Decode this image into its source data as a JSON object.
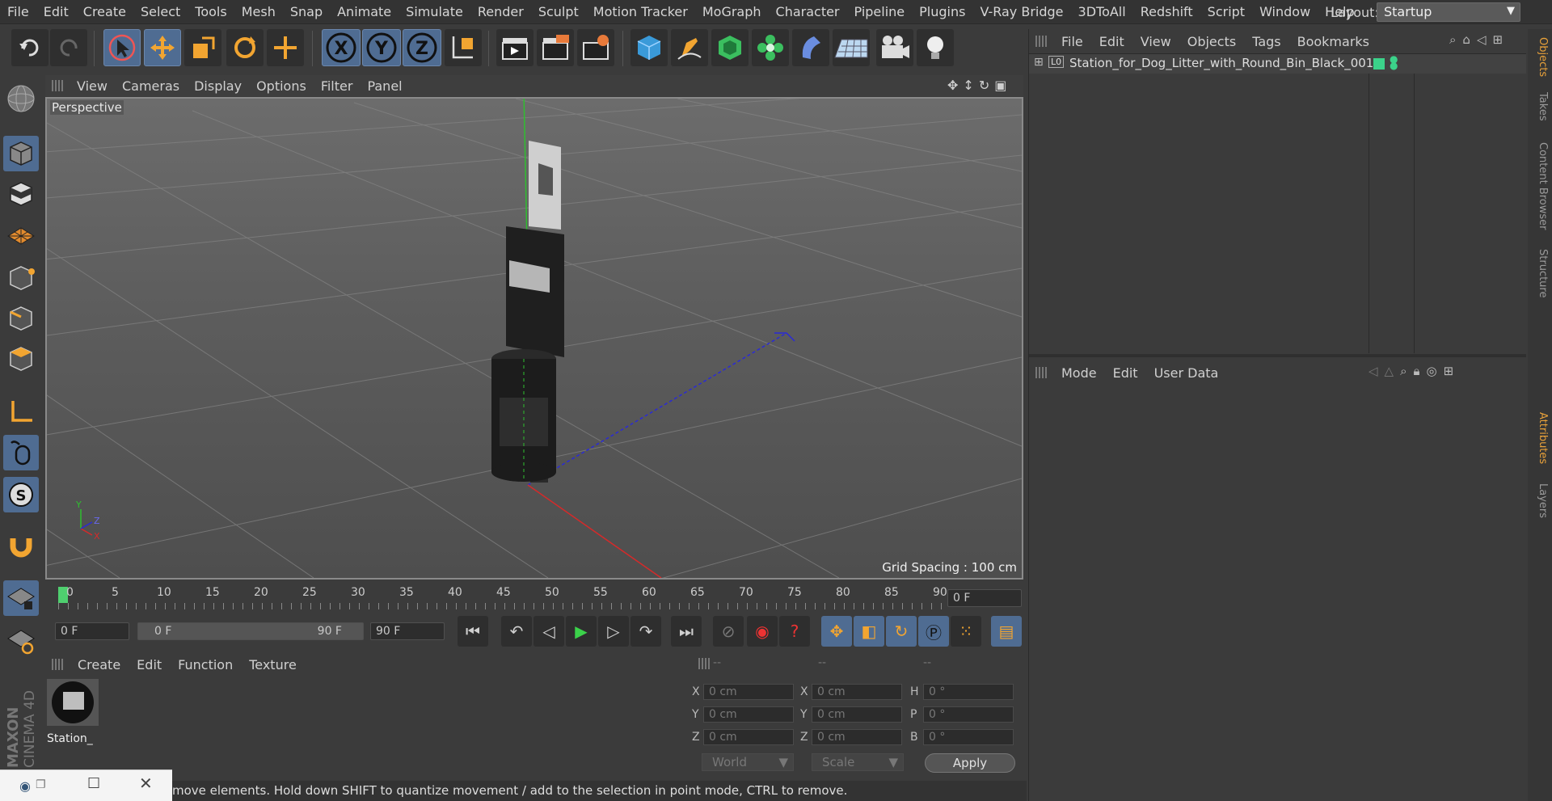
{
  "menu": [
    "File",
    "Edit",
    "Create",
    "Select",
    "Tools",
    "Mesh",
    "Snap",
    "Animate",
    "Simulate",
    "Render",
    "Sculpt",
    "Motion Tracker",
    "MoGraph",
    "Character",
    "Pipeline",
    "Plugins",
    "V-Ray Bridge",
    "3DToAll",
    "Redshift",
    "Script",
    "Window",
    "Help"
  ],
  "layout": {
    "label": "Layout:",
    "value": "Startup"
  },
  "viewport": {
    "menu": [
      "View",
      "Cameras",
      "Display",
      "Options",
      "Filter",
      "Panel"
    ],
    "camera_label": "Perspective",
    "grid_spacing": "Grid Spacing : 100 cm"
  },
  "timeline": {
    "ticks": [
      "0",
      "5",
      "10",
      "15",
      "20",
      "25",
      "30",
      "35",
      "40",
      "45",
      "50",
      "55",
      "60",
      "65",
      "70",
      "75",
      "80",
      "85",
      "90"
    ],
    "current_frame": "0 F",
    "start_frame": "0 F",
    "range_start": "0 F",
    "range_end": "90 F",
    "end_frame": "90 F"
  },
  "material_manager": {
    "menu": [
      "Create",
      "Edit",
      "Function",
      "Texture"
    ],
    "material_name": "Station_"
  },
  "coordinates": {
    "headers": [
      "--",
      "--",
      "--"
    ],
    "pos": [
      {
        "axis": "X",
        "value": "0 cm"
      },
      {
        "axis": "Y",
        "value": "0 cm"
      },
      {
        "axis": "Z",
        "value": "0 cm"
      }
    ],
    "size": [
      {
        "axis": "X",
        "value": "0 cm"
      },
      {
        "axis": "Y",
        "value": "0 cm"
      },
      {
        "axis": "Z",
        "value": "0 cm"
      }
    ],
    "rot": [
      {
        "axis": "H",
        "value": "0 °"
      },
      {
        "axis": "P",
        "value": "0 °"
      },
      {
        "axis": "B",
        "value": "0 °"
      }
    ],
    "mode_world": "World",
    "mode_scale": "Scale",
    "apply": "Apply"
  },
  "status_text": "move elements. Hold down SHIFT to quantize movement / add to the selection in point mode, CTRL to remove.",
  "object_manager": {
    "menu": [
      "File",
      "Edit",
      "View",
      "Objects",
      "Tags",
      "Bookmarks"
    ],
    "object_name": "Station_for_Dog_Litter_with_Round_Bin_Black_001",
    "layer_badge": "L0"
  },
  "attributes": {
    "menu": [
      "Mode",
      "Edit",
      "User Data"
    ]
  },
  "side_tabs": [
    "Objects",
    "Takes",
    "Content Browser",
    "Structure",
    "Attributes",
    "Layers"
  ],
  "brand": "MAXON CINEMA 4D",
  "colors": {
    "accent": "#e8a13a",
    "selection": "#4f6c92",
    "viewport_border": "#8a8a8a"
  }
}
